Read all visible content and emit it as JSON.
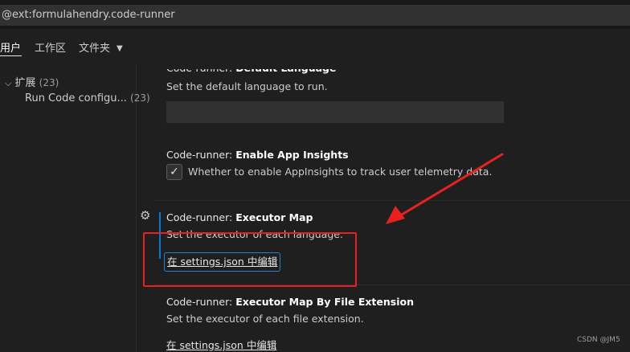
{
  "search": {
    "query": "@ext:formulahendry.code-runner"
  },
  "tabs": [
    {
      "label": "用户",
      "active": true
    },
    {
      "label": "工作区"
    },
    {
      "label": "文件夹"
    }
  ],
  "sidebar": {
    "extensions_label": "扩展",
    "extensions_count": "(23)",
    "item_label": "Run Code configu...",
    "item_count": "(23)"
  },
  "settings": [
    {
      "prefix": "Code-runner: ",
      "name": "Default Language",
      "description": "Set the default language to run."
    },
    {
      "prefix": "Code-runner: ",
      "name": "Enable App Insights",
      "description": "Whether to enable AppInsights to track user telemetry data.",
      "checked": true
    },
    {
      "prefix": "Code-runner: ",
      "name": "Executor Map",
      "description": "Set the executor of each language.",
      "link": "在 settings.json 中编辑"
    },
    {
      "prefix": "Code-runner: ",
      "name": "Executor Map By File Extension",
      "description": "Set the executor of each file extension.",
      "link": "在 settings.json 中编辑"
    }
  ],
  "watermark": "CSDN @JM5",
  "colors": {
    "annotation": "#e8211f",
    "focus": "#0078d4"
  },
  "icons": {
    "gear": "gear-icon",
    "check": "check-icon",
    "chevron": "chevron-down-icon"
  }
}
